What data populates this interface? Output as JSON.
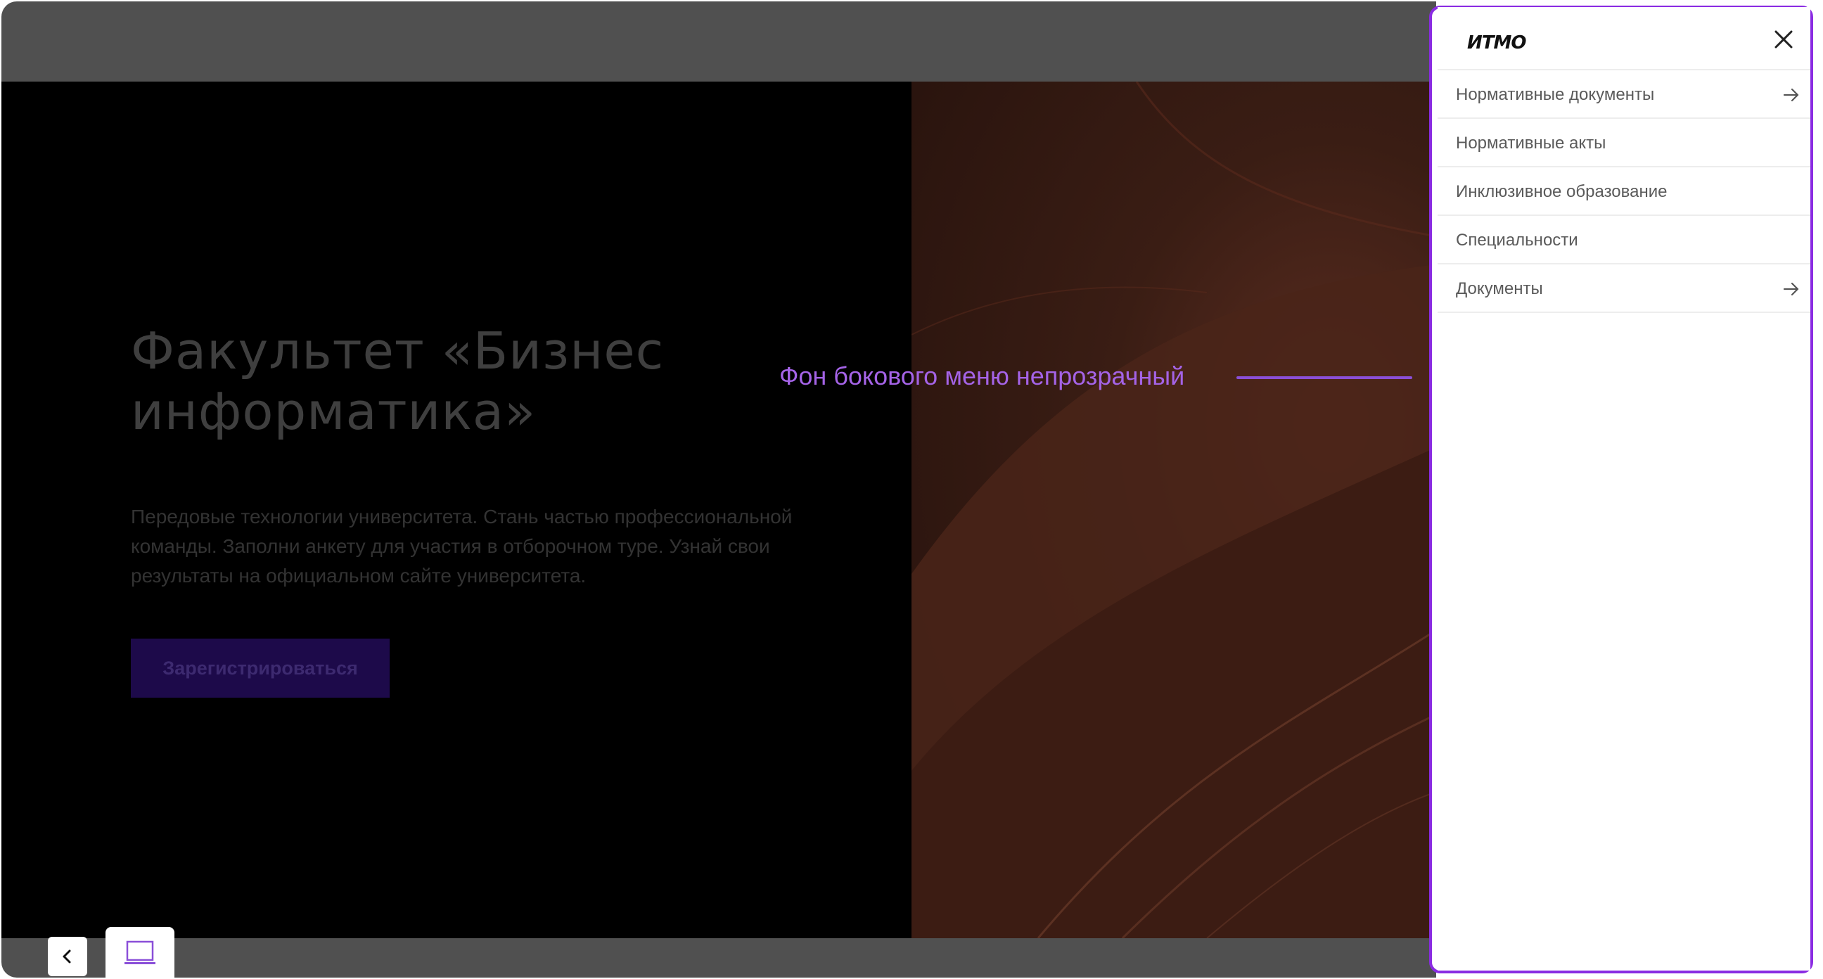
{
  "hero": {
    "title_line1": "Факультет «Бизнес",
    "title_line2": "информатика»",
    "description": "Передовые технологии университета. Стань частью профессиональной команды. Заполни анкету для участия в отборочном туре. Узнай свои результаты на официальном сайте университета.",
    "cta_label": "Зарегистрироваться"
  },
  "annotation": {
    "text": "Фон бокового меню непрозрачный"
  },
  "menu": {
    "logo": "ИTMO",
    "items": [
      {
        "label": "Нормативные документы",
        "has_arrow": true
      },
      {
        "label": "Нормативные акты",
        "has_arrow": false
      },
      {
        "label": "Инклюзивное образование",
        "has_arrow": false
      },
      {
        "label": "Специальности",
        "has_arrow": false
      },
      {
        "label": "Документы",
        "has_arrow": true
      }
    ]
  },
  "toolbar": {
    "back_icon": "chevron-left-icon",
    "device_icon": "laptop-icon"
  },
  "colors": {
    "accent": "#8a2be2",
    "annotation": "#a463e6",
    "cta_bg": "#1d0a4a",
    "overlay": "#505050"
  }
}
